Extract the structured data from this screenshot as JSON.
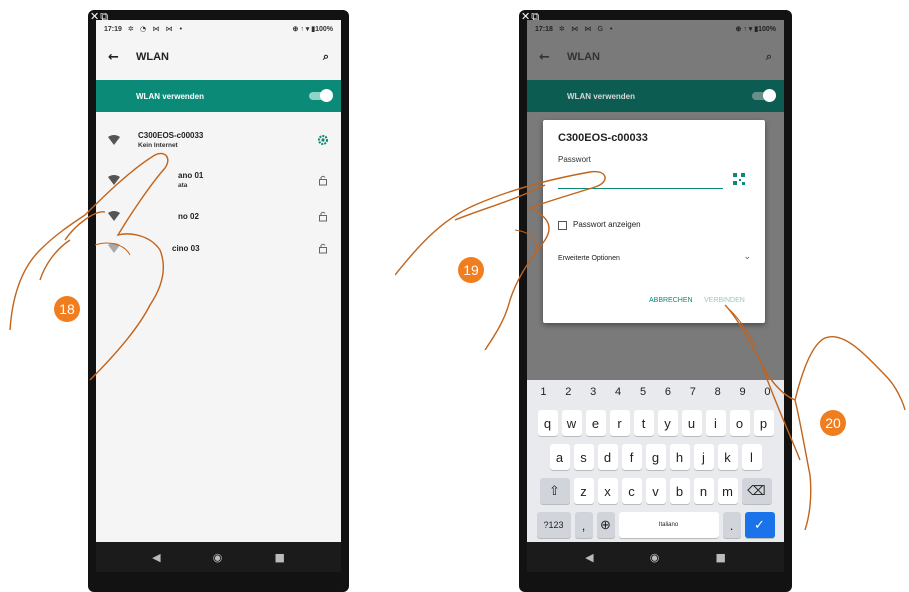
{
  "left_phone": {
    "camera_icons": "✕⧉",
    "status": {
      "time": "17:19",
      "icons": "✲ ◔ ⋈ ⋈ •",
      "right": "⊕ ↑ ▾ ▮100%"
    },
    "app_bar": {
      "title": "WLAN"
    },
    "wlan_toggle": {
      "label": "WLAN verwenden",
      "on": true
    },
    "networks": [
      {
        "name": "C300EOS-c00033",
        "subtitle": "Kein Internet",
        "trailing": "gear-icon"
      },
      {
        "name": "ano 01",
        "subtitle": "ata",
        "trailing": "lock-icon"
      },
      {
        "name": "no 02",
        "subtitle": "",
        "trailing": "lock-icon"
      },
      {
        "name": "cino 03",
        "subtitle": "",
        "trailing": "lock-icon"
      }
    ],
    "nav": {
      "back": "◀",
      "home": "◉",
      "recents": "■"
    }
  },
  "right_phone": {
    "camera_icons": "✕⧉",
    "status": {
      "time": "17:18",
      "icons": "✲ ⋈ ⋈ G •",
      "right": "⊕ ↑ ▾ ▮100%"
    },
    "app_bar": {
      "title": "WLAN"
    },
    "wlan_toggle": {
      "label": "WLAN verwenden"
    },
    "dialog": {
      "title": "C300EOS-c00033",
      "password_label": "Passwort",
      "password_value": "",
      "show_password_label": "Passwort anzeigen",
      "advanced_label": "Erweiterte Optionen",
      "cancel_label": "ABBRECHEN",
      "connect_label": "VERBINDEN"
    },
    "keyboard": {
      "numbers": [
        "1",
        "2",
        "3",
        "4",
        "5",
        "6",
        "7",
        "8",
        "9",
        "0"
      ],
      "row1": [
        "q",
        "w",
        "e",
        "r",
        "t",
        "y",
        "u",
        "i",
        "o",
        "p"
      ],
      "row2": [
        "a",
        "s",
        "d",
        "f",
        "g",
        "h",
        "j",
        "k",
        "l"
      ],
      "row3": [
        "z",
        "x",
        "c",
        "v",
        "b",
        "n",
        "m"
      ],
      "symbols_key": "?123",
      "comma_key": ",",
      "globe_key": "⊕",
      "space_label": "Italiano",
      "period_key": ".",
      "shift_key": "⇧",
      "backspace_key": "⌫",
      "enter_key": "✓"
    },
    "nav": {
      "back": "◀",
      "home": "◉",
      "recents": "■"
    }
  },
  "steps": {
    "step1": "18",
    "step2": "19",
    "step3": "20"
  },
  "colors": {
    "accent": "#0a8a77",
    "badge": "#f07e1f",
    "hand_outline": "#c2631a"
  }
}
